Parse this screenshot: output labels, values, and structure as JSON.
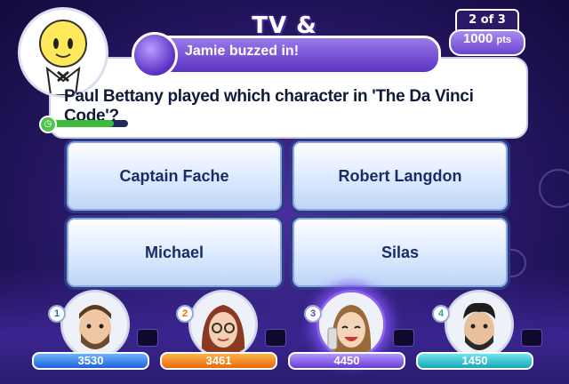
{
  "game": {
    "category_title": "TV & Film",
    "round": "2 of 3",
    "points_value": "1000",
    "points_unit": "pts"
  },
  "buzzer": {
    "text": "Jamie buzzed in!"
  },
  "question": {
    "text": "Paul Bettany played which character in 'The Da Vinci Code'?"
  },
  "timer": {
    "remaining_fraction": 0.82,
    "icon": "clock-icon"
  },
  "answers": [
    {
      "label": "Captain Fache"
    },
    {
      "label": "Robert Langdon"
    },
    {
      "label": "Michael"
    },
    {
      "label": "Silas"
    }
  ],
  "players": [
    {
      "number": "1",
      "score": "3530",
      "color": "#1f63d6"
    },
    {
      "number": "2",
      "score": "3461",
      "color": "#e86a0c"
    },
    {
      "number": "3",
      "score": "4450",
      "color": "#6a3cd2"
    },
    {
      "number": "4",
      "score": "1450",
      "color": "#1aa6b6"
    }
  ]
}
